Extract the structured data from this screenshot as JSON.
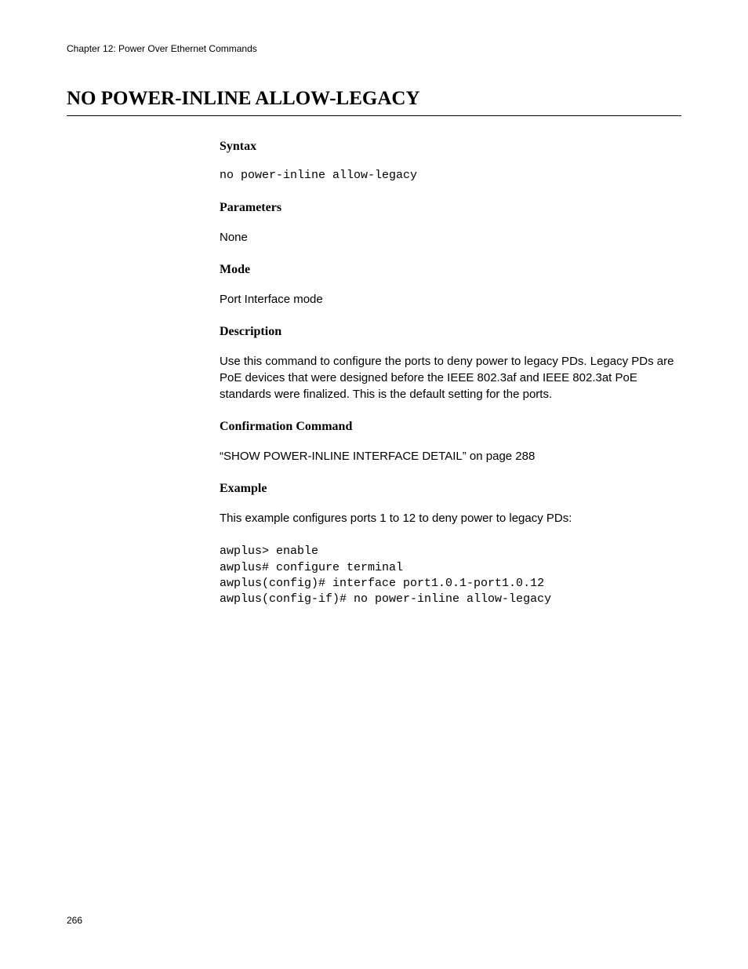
{
  "header": {
    "chapter": "Chapter 12: Power Over Ethernet Commands"
  },
  "title": "NO POWER-INLINE ALLOW-LEGACY",
  "sections": {
    "syntax": {
      "heading": "Syntax",
      "code": "no power-inline allow-legacy"
    },
    "parameters": {
      "heading": "Parameters",
      "text": "None"
    },
    "mode": {
      "heading": "Mode",
      "text": "Port Interface mode"
    },
    "description": {
      "heading": "Description",
      "text": "Use this command to configure the ports to deny power to legacy PDs. Legacy PDs are PoE devices that were designed before the IEEE 802.3af and IEEE 802.3at PoE standards were finalized. This is the default setting for the ports."
    },
    "confirmation": {
      "heading": "Confirmation Command",
      "text": "“SHOW POWER-INLINE INTERFACE DETAIL” on page 288"
    },
    "example": {
      "heading": "Example",
      "text": "This example configures ports 1 to 12 to deny power to legacy PDs:",
      "code": "awplus> enable\nawplus# configure terminal\nawplus(config)# interface port1.0.1-port1.0.12\nawplus(config-if)# no power-inline allow-legacy"
    }
  },
  "pageNumber": "266"
}
